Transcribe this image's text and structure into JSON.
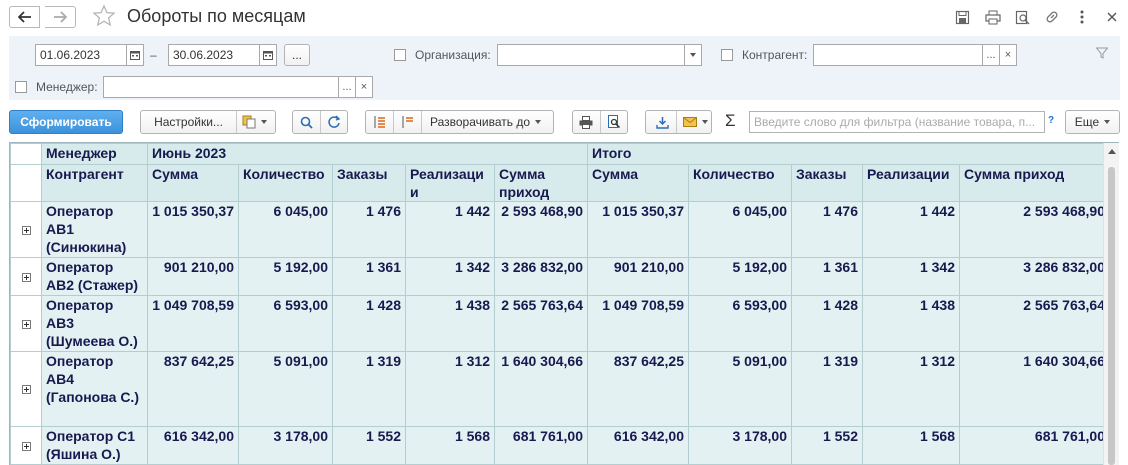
{
  "window": {
    "title": "Обороты по месяцам"
  },
  "filters": {
    "date_from": "01.06.2023",
    "date_dash": "–",
    "date_to": "30.06.2023",
    "period_btn": "...",
    "org_label": "Организация:",
    "org_value": "",
    "contractor_label": "Контрагент:",
    "contractor_value": "",
    "manager_label": "Менеджер:",
    "manager_value": "",
    "dots": "...",
    "clear": "×"
  },
  "toolbar": {
    "generate": "Сформировать",
    "settings": "Настройки...",
    "expand_to": "Разворачивать до",
    "sigma": "Σ",
    "search_placeholder": "Введите слово для фильтра (название товара, п...",
    "help": "?",
    "more": "Еще"
  },
  "table": {
    "header1": {
      "manager": "Менеджер",
      "period": "Июнь 2023",
      "total": "Итого"
    },
    "header2": [
      "Контрагент",
      "Сумма",
      "Количество",
      "Заказы",
      "Реализаци и",
      "Сумма приход",
      "Сумма",
      "Количество",
      "Заказы",
      "Реализации",
      "Сумма приход"
    ],
    "rows": [
      {
        "name": "Оператор АВ1 (Синюкина)",
        "values": [
          "1 015 350,37",
          "6 045,00",
          "1 476",
          "1 442",
          "2 593 468,90",
          "1 015 350,37",
          "6 045,00",
          "1 476",
          "1 442",
          "2 593 468,90"
        ]
      },
      {
        "name": "Оператор АВ2 (Стажер)",
        "values": [
          "901 210,00",
          "5 192,00",
          "1 361",
          "1 342",
          "3 286 832,00",
          "901 210,00",
          "5 192,00",
          "1 361",
          "1 342",
          "3 286 832,00"
        ]
      },
      {
        "name": "Оператор АВ3 (Шумеева О.)",
        "values": [
          "1 049 708,59",
          "6 593,00",
          "1 428",
          "1 438",
          "2 565 763,64",
          "1 049 708,59",
          "6 593,00",
          "1 428",
          "1 438",
          "2 565 763,64"
        ]
      },
      {
        "name": "Оператор АВ4 (Гапонова С.)",
        "values": [
          "837 642,25",
          "5 091,00",
          "1 319",
          "1 312",
          "1 640 304,66",
          "837 642,25",
          "5 091,00",
          "1 319",
          "1 312",
          "1 640 304,66"
        ]
      },
      {
        "name": "Оператор С1 (Яшина О.)",
        "values": [
          "616 342,00",
          "3 178,00",
          "1 552",
          "1 568",
          "681 761,00",
          "616 342,00",
          "3 178,00",
          "1 552",
          "1 568",
          "681 761,00"
        ]
      }
    ]
  },
  "icons": [
    "back-arrow-icon",
    "forward-arrow-icon",
    "star-icon",
    "save-icon",
    "print-icon",
    "preview-icon",
    "link-icon",
    "more-vert-icon",
    "close-icon",
    "calendar-icon",
    "funnel-icon",
    "copy-icon",
    "search-icon",
    "refresh-icon",
    "expand-all-icon",
    "collapse-all-icon",
    "printer-icon",
    "print-preview-icon",
    "download-icon",
    "envelope-icon"
  ]
}
